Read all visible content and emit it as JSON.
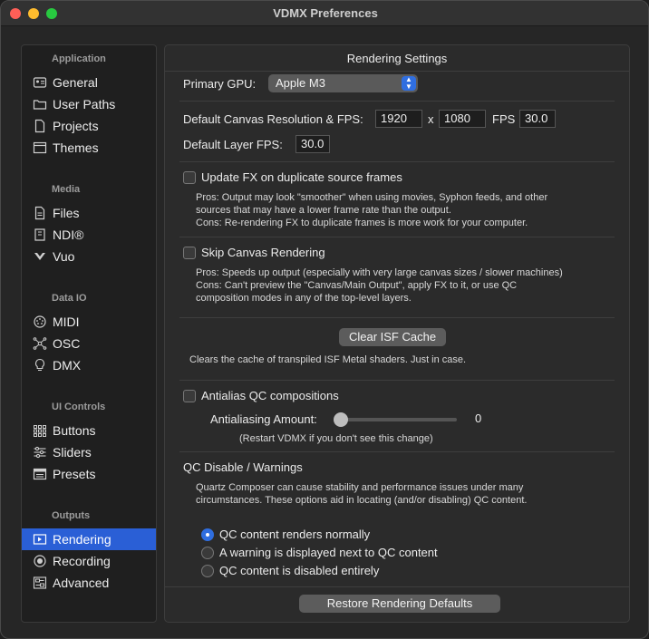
{
  "window": {
    "title": "VDMX Preferences"
  },
  "sidebar": {
    "sections": [
      {
        "title": "Application",
        "items": [
          {
            "label": "General",
            "icon": "id-card-icon"
          },
          {
            "label": "User Paths",
            "icon": "folder-icon"
          },
          {
            "label": "Projects",
            "icon": "document-icon"
          },
          {
            "label": "Themes",
            "icon": "window-icon"
          }
        ]
      },
      {
        "title": "Media",
        "items": [
          {
            "label": "Files",
            "icon": "file-icon"
          },
          {
            "label": "NDI®",
            "icon": "ndi-icon"
          },
          {
            "label": "Vuo",
            "icon": "vuo-icon"
          }
        ]
      },
      {
        "title": "Data IO",
        "items": [
          {
            "label": "MIDI",
            "icon": "midi-icon"
          },
          {
            "label": "OSC",
            "icon": "network-icon"
          },
          {
            "label": "DMX",
            "icon": "lightbulb-icon"
          }
        ]
      },
      {
        "title": "UI Controls",
        "items": [
          {
            "label": "Buttons",
            "icon": "grid-icon"
          },
          {
            "label": "Sliders",
            "icon": "sliders-icon"
          },
          {
            "label": "Presets",
            "icon": "presets-icon"
          }
        ]
      },
      {
        "title": "Outputs",
        "items": [
          {
            "label": "Rendering",
            "icon": "rendering-icon",
            "selected": true
          },
          {
            "label": "Recording",
            "icon": "record-icon"
          },
          {
            "label": "Advanced",
            "icon": "advanced-icon"
          }
        ]
      }
    ]
  },
  "panel": {
    "title": "Rendering Settings",
    "gpu": {
      "label": "Primary GPU:",
      "value": "Apple M3"
    },
    "canvas": {
      "label": "Default Canvas Resolution & FPS:",
      "width": "1920",
      "x_label": "x",
      "height": "1080",
      "fps_label": "FPS",
      "fps": "30.0"
    },
    "layer_fps": {
      "label": "Default Layer FPS:",
      "value": "30.0"
    },
    "update_fx": {
      "label": "Update FX on duplicate source frames",
      "desc1": "Pros: Output may look \"smoother\" when using movies, Syphon feeds, and other",
      "desc2": "sources that may have a lower frame rate than the output.",
      "desc3": "Cons: Re-rendering FX to duplicate frames is more work for your computer.",
      "checked": false
    },
    "skip_canvas": {
      "label": "Skip Canvas Rendering",
      "desc1": "Pros: Speeds up output (especially with very large canvas sizes / slower machines)",
      "desc2": "Cons: Can't preview  the \"Canvas/Main Output\", apply FX to it, or use QC",
      "desc3": "composition modes in any of the top-level layers.",
      "checked": false
    },
    "isf": {
      "button": "Clear ISF Cache",
      "desc": "Clears the cache of transpiled ISF Metal shaders. Just in case."
    },
    "antialias": {
      "label": "Antialias QC compositions",
      "amount_label": "Antialiasing Amount:",
      "amount_value": "0",
      "amount_fraction": 0,
      "note": "(Restart VDMX if you don't see this change)",
      "checked": false
    },
    "qc": {
      "title": "QC Disable / Warnings",
      "desc1": "Quartz Composer can cause stability and performance issues under many",
      "desc2": "circumstances. These options aid in locating (and/or disabling) QC content.",
      "options": [
        {
          "label": "QC content renders normally",
          "selected": true
        },
        {
          "label": "A warning is displayed next to QC content",
          "selected": false
        },
        {
          "label": "QC content is disabled entirely",
          "selected": false
        }
      ]
    },
    "restore_button": "Restore Rendering Defaults"
  }
}
